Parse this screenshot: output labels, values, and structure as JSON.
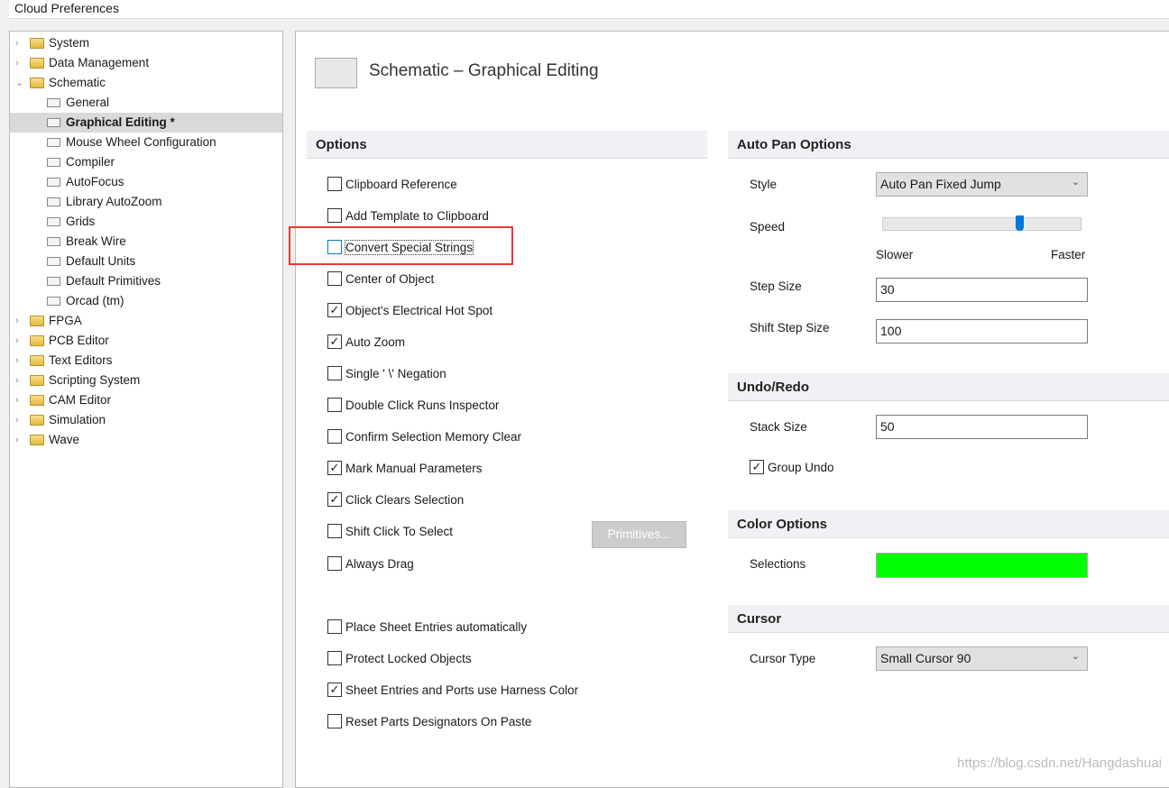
{
  "window": {
    "title": "Cloud Preferences"
  },
  "tree": [
    {
      "label": "System",
      "level": 0,
      "expanded": false
    },
    {
      "label": "Data Management",
      "level": 0,
      "expanded": false
    },
    {
      "label": "Schematic",
      "level": 0,
      "expanded": true
    },
    {
      "label": "General",
      "level": 1
    },
    {
      "label": "Graphical Editing *",
      "level": 1,
      "selected": true
    },
    {
      "label": "Mouse Wheel Configuration",
      "level": 1
    },
    {
      "label": "Compiler",
      "level": 1
    },
    {
      "label": "AutoFocus",
      "level": 1
    },
    {
      "label": "Library AutoZoom",
      "level": 1
    },
    {
      "label": "Grids",
      "level": 1
    },
    {
      "label": "Break Wire",
      "level": 1
    },
    {
      "label": "Default Units",
      "level": 1
    },
    {
      "label": "Default Primitives",
      "level": 1
    },
    {
      "label": "Orcad (tm)",
      "level": 1
    },
    {
      "label": "FPGA",
      "level": 0,
      "expanded": false
    },
    {
      "label": "PCB Editor",
      "level": 0,
      "expanded": false
    },
    {
      "label": "Text Editors",
      "level": 0,
      "expanded": false
    },
    {
      "label": "Scripting System",
      "level": 0,
      "expanded": false
    },
    {
      "label": "CAM Editor",
      "level": 0,
      "expanded": false
    },
    {
      "label": "Simulation",
      "level": 0,
      "expanded": false
    },
    {
      "label": "Wave",
      "level": 0,
      "expanded": false
    }
  ],
  "page": {
    "title": "Schematic – Graphical Editing"
  },
  "options": {
    "header": "Options",
    "items": [
      {
        "label": "Clipboard Reference",
        "checked": false
      },
      {
        "label": "Add Template to Clipboard",
        "checked": false
      },
      {
        "label": "Convert Special Strings",
        "checked": false,
        "focused": true
      },
      {
        "label": "Center of Object",
        "checked": false
      },
      {
        "label": "Object's Electrical Hot Spot",
        "checked": true
      },
      {
        "label": "Auto Zoom",
        "checked": true
      },
      {
        "label": "Single ' \\' Negation",
        "checked": false
      },
      {
        "label": "Double Click Runs Inspector",
        "checked": false
      },
      {
        "label": "Confirm Selection Memory Clear",
        "checked": false
      },
      {
        "label": "Mark Manual Parameters",
        "checked": true
      },
      {
        "label": "Click Clears Selection",
        "checked": true
      },
      {
        "label": "Shift Click To Select",
        "checked": false
      },
      {
        "label": "Always Drag",
        "checked": false
      },
      {
        "label": "Place Sheet Entries automatically",
        "checked": false
      },
      {
        "label": "Protect Locked Objects",
        "checked": false
      },
      {
        "label": "Sheet Entries and Ports use Harness Color",
        "checked": true
      },
      {
        "label": "Reset Parts Designators On Paste",
        "checked": false
      }
    ],
    "primitives_button": "Primitives..."
  },
  "autopan": {
    "header": "Auto Pan Options",
    "style_label": "Style",
    "style_value": "Auto Pan Fixed Jump",
    "speed_label": "Speed",
    "speed_fraction": 0.69,
    "slower": "Slower",
    "faster": "Faster",
    "step_label": "Step Size",
    "step_value": "30",
    "shift_label": "Shift Step Size",
    "shift_value": "100"
  },
  "undo": {
    "header": "Undo/Redo",
    "stack_label": "Stack Size",
    "stack_value": "50",
    "group_label": "Group Undo",
    "group_checked": true
  },
  "color": {
    "header": "Color Options",
    "selections_label": "Selections",
    "selections_color": "#00ff00"
  },
  "cursor": {
    "header": "Cursor",
    "type_label": "Cursor Type",
    "type_value": "Small Cursor 90"
  },
  "watermark": "https://blog.csdn.net/Hangdashuai"
}
